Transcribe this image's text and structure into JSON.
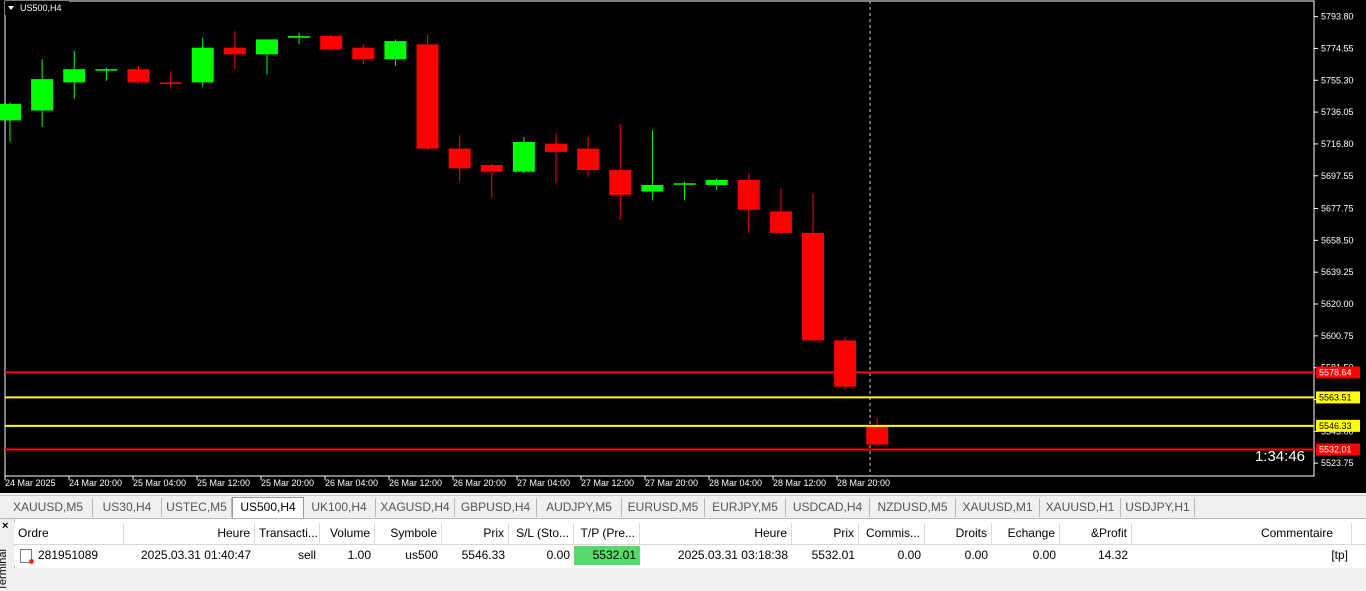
{
  "chart": {
    "symbol_title": "US500,H4",
    "countdown": "1:34:46",
    "price_range": [
      5516,
      5799
    ],
    "price_ticks": [
      "5793.80",
      "5774.55",
      "5755.30",
      "5736.05",
      "5716.80",
      "5697.55",
      "5677.75",
      "5658.50",
      "5639.25",
      "5620.00",
      "5600.75",
      "5581.50",
      "5562.25",
      "5543.00",
      "5523.75"
    ],
    "time_labels": [
      "24 Mar 2025",
      "24 Mar 20:00",
      "25 Mar 04:00",
      "25 Mar 12:00",
      "25 Mar 20:00",
      "26 Mar 04:00",
      "26 Mar 12:00",
      "26 Mar 20:00",
      "27 Mar 04:00",
      "27 Mar 12:00",
      "27 Mar 20:00",
      "28 Mar 04:00",
      "28 Mar 12:00",
      "28 Mar 20:00"
    ],
    "level_lines": [
      {
        "price": 5578.64,
        "label": "5578.64",
        "color": "#ff0000",
        "label_bg": "#ff0000",
        "label_fg": "#ffffff"
      },
      {
        "price": 5563.51,
        "label": "5563.51",
        "color": "#ffff00",
        "label_bg": "#ffff00",
        "label_fg": "#000000"
      },
      {
        "price": 5546.33,
        "label": "5546.33",
        "color": "#ffff00",
        "label_bg": "#ffff00",
        "label_fg": "#000000"
      },
      {
        "price": 5532.01,
        "label": "5532.01",
        "color": "#ff0000",
        "label_bg": "#ff0000",
        "label_fg": "#ffffff"
      }
    ],
    "colors": {
      "bull": "#00ff00",
      "bear": "#ff0000",
      "background": "#000000",
      "axis_text": "#ffffff"
    },
    "candles": [
      {
        "o": 5731,
        "h": 5742,
        "l": 5718,
        "c": 5741
      },
      {
        "o": 5737,
        "h": 5768,
        "l": 5727,
        "c": 5756
      },
      {
        "o": 5754,
        "h": 5773,
        "l": 5744,
        "c": 5762
      },
      {
        "o": 5762,
        "h": 5763,
        "l": 5755,
        "c": 5762
      },
      {
        "o": 5762,
        "h": 5764,
        "l": 5753,
        "c": 5754
      },
      {
        "o": 5754,
        "h": 5760,
        "l": 5751,
        "c": 5753
      },
      {
        "o": 5754,
        "h": 5781,
        "l": 5751,
        "c": 5775
      },
      {
        "o": 5775,
        "h": 5785,
        "l": 5762,
        "c": 5771
      },
      {
        "o": 5771,
        "h": 5780,
        "l": 5759,
        "c": 5780
      },
      {
        "o": 5781,
        "h": 5784,
        "l": 5777,
        "c": 5782
      },
      {
        "o": 5782,
        "h": 5783,
        "l": 5773,
        "c": 5774
      },
      {
        "o": 5775,
        "h": 5777,
        "l": 5765,
        "c": 5768
      },
      {
        "o": 5768,
        "h": 5780,
        "l": 5764,
        "c": 5779
      },
      {
        "o": 5777,
        "h": 5783,
        "l": 5713,
        "c": 5714
      },
      {
        "o": 5714,
        "h": 5722,
        "l": 5694,
        "c": 5702
      },
      {
        "o": 5704,
        "h": 5705,
        "l": 5684,
        "c": 5700
      },
      {
        "o": 5700,
        "h": 5721,
        "l": 5699,
        "c": 5718
      },
      {
        "o": 5717,
        "h": 5723,
        "l": 5693,
        "c": 5712
      },
      {
        "o": 5714,
        "h": 5721,
        "l": 5697,
        "c": 5701
      },
      {
        "o": 5701,
        "h": 5729,
        "l": 5671,
        "c": 5686
      },
      {
        "o": 5688,
        "h": 5725,
        "l": 5683,
        "c": 5692
      },
      {
        "o": 5693,
        "h": 5694,
        "l": 5683,
        "c": 5693
      },
      {
        "o": 5692,
        "h": 5696,
        "l": 5689,
        "c": 5695
      },
      {
        "o": 5695,
        "h": 5699,
        "l": 5663,
        "c": 5677
      },
      {
        "o": 5676,
        "h": 5690,
        "l": 5662,
        "c": 5663
      },
      {
        "o": 5663,
        "h": 5687,
        "l": 5597,
        "c": 5598
      },
      {
        "o": 5598,
        "h": 5600,
        "l": 5568,
        "c": 5570
      },
      {
        "o": 5546,
        "h": 5551,
        "l": 5534,
        "c": 5535
      }
    ]
  },
  "tabs": [
    "XAUUSD,M5",
    "US30,H4",
    "USTEC,M5",
    "US500,H4",
    "UK100,H4",
    "XAGUSD,H4",
    "GBPUSD,H4",
    "AUDJPY,M5",
    "EURUSD,M5",
    "EURJPY,M5",
    "USDCAD,H4",
    "NZDUSD,M5",
    "XAUUSD,M1",
    "XAUUSD,H1",
    "USDJPY,H1"
  ],
  "active_tab": "US500,H4",
  "terminal": {
    "side_label": "Terminal",
    "columns": [
      "Ordre",
      "Heure",
      "Transacti...",
      "Volume",
      "Symbole",
      "Prix",
      "S/L (Sto...",
      "T/P (Pre...",
      "Heure",
      "Prix",
      "Commis...",
      "Droits",
      "Echange",
      "&Profit",
      "Commentaire"
    ],
    "row": [
      "281951089",
      "2025.03.31 01:40:47",
      "sell",
      "1.00",
      "us500",
      "5546.33",
      "0.00",
      "5532.01",
      "2025.03.31 03:18:38",
      "5532.01",
      "0.00",
      "0.00",
      "0.00",
      "14.32",
      "[tp]"
    ],
    "tp_highlight": "#57d96b"
  }
}
